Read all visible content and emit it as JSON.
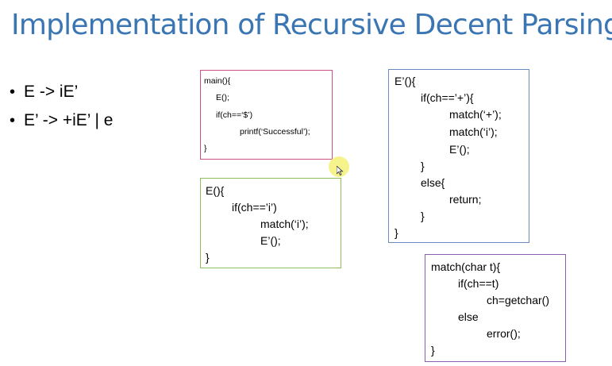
{
  "slide": {
    "title": "Implementation of Recursive Decent Parsing",
    "bullets": [
      "E -> iE’",
      "E’ -> +iE’ | e"
    ]
  },
  "boxes": {
    "main": {
      "lines": [
        "main(){",
        "E();",
        "if(ch==‘$’)",
        "printf(‘Successful’);",
        "}"
      ]
    },
    "e": {
      "lines": [
        "E(){",
        "if(ch==’i’)",
        "match(‘i’);",
        "E’();",
        "}"
      ]
    },
    "eprime": {
      "lines": [
        "E’(){",
        "if(ch==’+’){",
        "match(‘+’);",
        "match(‘i’);",
        "E’();",
        "}",
        "else{",
        "return;",
        "}",
        "}"
      ]
    },
    "match": {
      "lines": [
        "match(char t){",
        "if(ch==t)",
        "ch=getchar()",
        "else",
        "error();",
        "}"
      ]
    }
  },
  "colors": {
    "title": "#3a76b3",
    "main_border": "#d04f87",
    "e_border": "#8cbf5a",
    "eprime_border": "#6a8bbf",
    "match_border": "#8a5fb0",
    "cursor_highlight": "#f5f078"
  },
  "icons": {
    "cursor": "mouse-pointer-icon"
  }
}
